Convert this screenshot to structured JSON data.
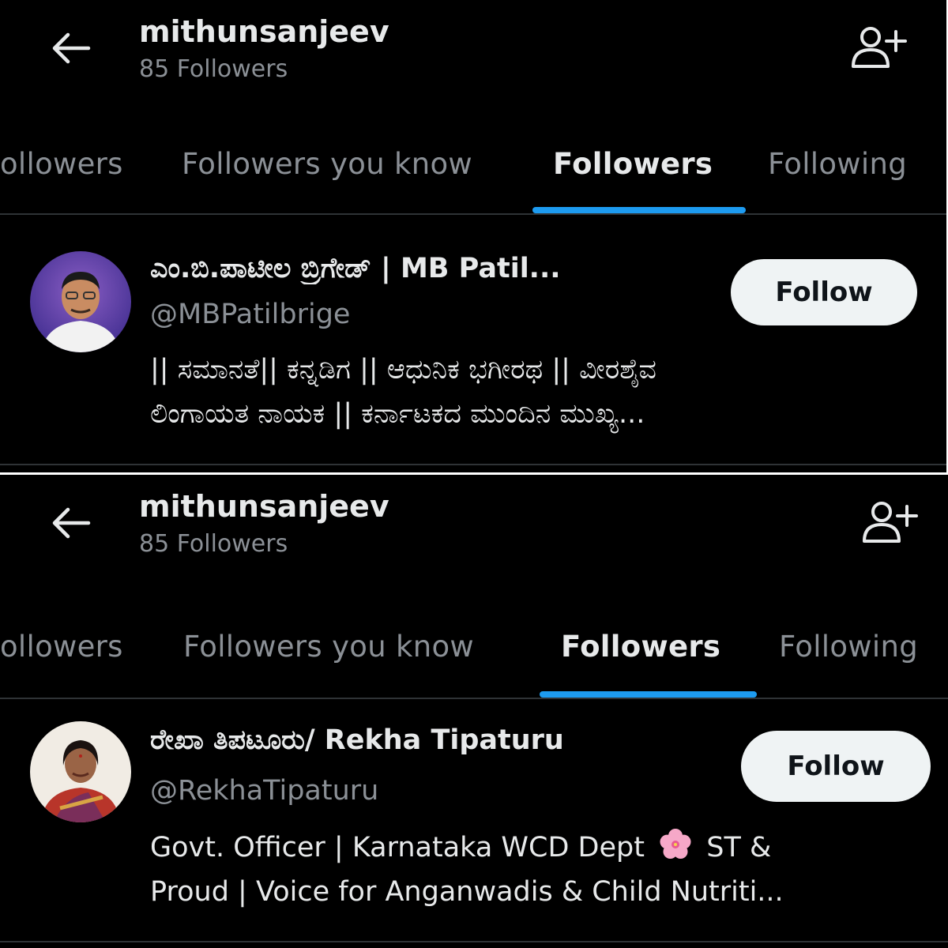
{
  "panels": [
    {
      "header": {
        "title": "mithunsanjeev",
        "subtitle": "85 Followers",
        "back_icon": "arrow-left-icon",
        "add_person_icon": "add-person-icon"
      },
      "tabs": [
        "ollowers",
        "Followers you know",
        "Followers",
        "Following"
      ],
      "active_tab": "Followers",
      "user": {
        "name": "ಎಂ.ಬಿ.ಪಾಟೀಲ ಬ್ರಿಗೇಡ್ | MB Patil...",
        "handle": "@MBPatilbrige",
        "bio_line_1": "|| ಸಮಾನತೆ|| ಕನ್ನಡಿಗ || ಆಧುನಿಕ ಭಗೀರಥ || ವೀರಶೈವ",
        "bio_line_2": "ಲಿಂಗಾಯತ ನಾಯಕ || ಕರ್ನಾಟಕದ ಮುಂದಿನ ಮುಖ್ಯ...",
        "follow_label": "Follow"
      }
    },
    {
      "header": {
        "title": "mithunsanjeev",
        "subtitle": "85 Followers",
        "back_icon": "arrow-left-icon",
        "add_person_icon": "add-person-icon"
      },
      "tabs": [
        "ollowers",
        "Followers you know",
        "Followers",
        "Following"
      ],
      "active_tab": "Followers",
      "user": {
        "name": "ರೇಖಾ ತಿಪಟೂರು/ Rekha Tipaturu",
        "handle": "@RekhaTipaturu",
        "bio_line_1_text": "Govt. Officer | Karnataka WCD Dept",
        "bio_line_1_emoji": "cherry-blossom-icon",
        "bio_line_1_tail": "ST &",
        "bio_line_2": "Proud | Voice for Anganwadis & Child Nutriti...",
        "follow_label": "Follow"
      }
    }
  ],
  "colors": {
    "background": "#000000",
    "text": "#e7e9ea",
    "muted": "#8b9096",
    "accent": "#1d9bf0",
    "button_bg": "#eff3f4",
    "divider": "#2f3336"
  }
}
